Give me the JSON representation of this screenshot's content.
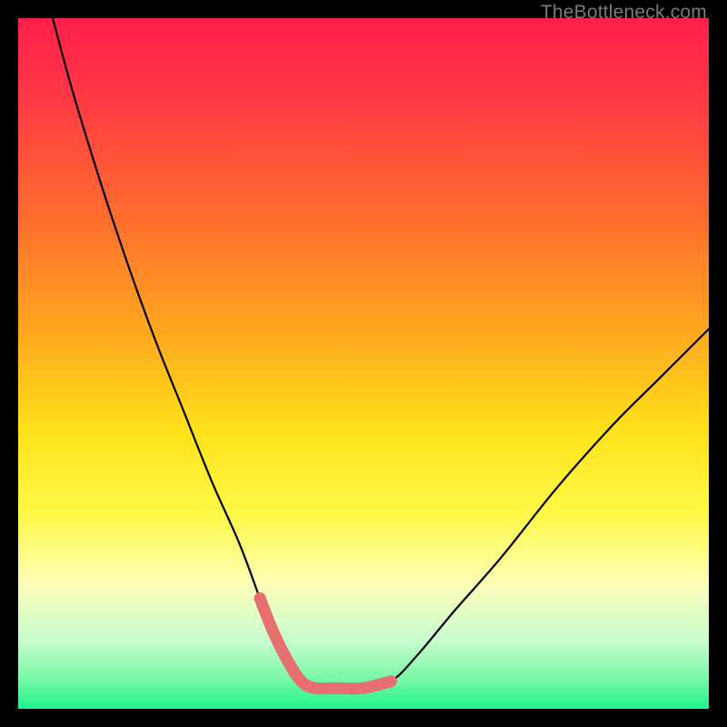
{
  "watermark_text": "TheBottleneck.com",
  "colors": {
    "frame": "#000000",
    "curve": "#000000",
    "highlight": "#e76f6f",
    "gradient_stops": [
      {
        "offset": 0.0,
        "color": "#ff1f4b"
      },
      {
        "offset": 0.12,
        "color": "#ff3a44"
      },
      {
        "offset": 0.28,
        "color": "#ff6a2f"
      },
      {
        "offset": 0.45,
        "color": "#ffa61f"
      },
      {
        "offset": 0.6,
        "color": "#ffe21a"
      },
      {
        "offset": 0.72,
        "color": "#fff94a"
      },
      {
        "offset": 0.82,
        "color": "#fdfeb8"
      },
      {
        "offset": 0.9,
        "color": "#c9fccf"
      },
      {
        "offset": 0.955,
        "color": "#7bf8a8"
      },
      {
        "offset": 1.0,
        "color": "#1df58b"
      }
    ]
  },
  "chart_data": {
    "type": "line",
    "title": "",
    "xlabel": "",
    "ylabel": "",
    "x_range": [
      0,
      100
    ],
    "y_range": [
      0,
      100
    ],
    "note": "Values are read in normalized 0–100 units inside the colored plot area. y=0 is the bottom (green), y=100 is the top (red).",
    "series": [
      {
        "name": "bottleneck-curve",
        "x": [
          5,
          8,
          12,
          16,
          20,
          24,
          28,
          32,
          35,
          37,
          39,
          41,
          43,
          46,
          50,
          54,
          58,
          63,
          70,
          78,
          86,
          93,
          100
        ],
        "y": [
          100,
          89,
          76,
          64,
          53,
          43,
          33,
          24,
          16,
          11,
          7,
          4,
          3,
          3,
          3,
          4,
          8,
          14,
          22,
          32,
          41,
          48,
          55
        ]
      }
    ],
    "highlight_segment": {
      "description": "thick pink stroke along curve bottom",
      "x": [
        35,
        37,
        39,
        41,
        43,
        46,
        50,
        54
      ],
      "y": [
        16,
        11,
        7,
        4,
        3,
        3,
        3,
        4
      ]
    }
  }
}
